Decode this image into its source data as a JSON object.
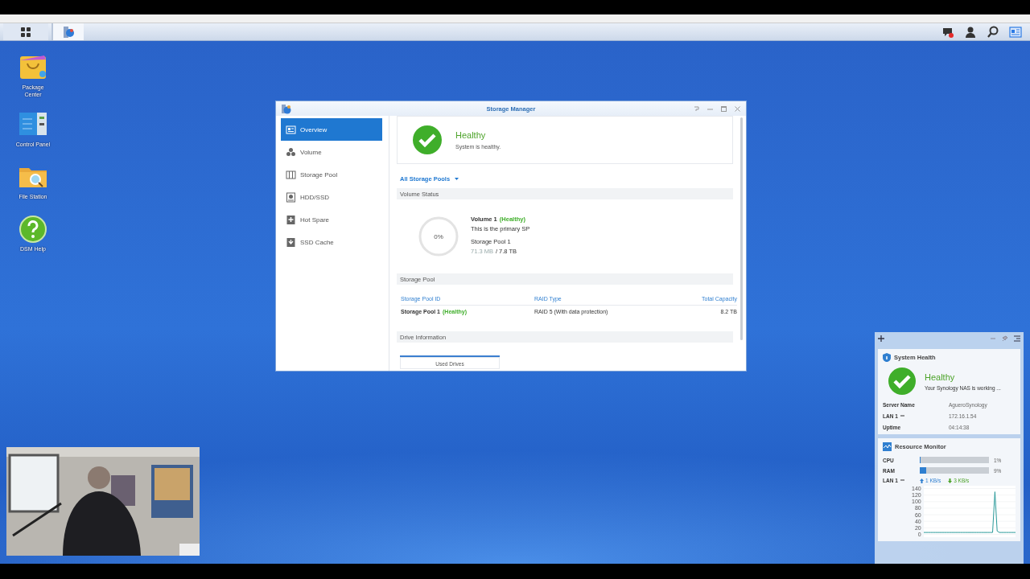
{
  "desktop_icons": [
    {
      "label": "Package Center",
      "kind": "package"
    },
    {
      "label": "Control Panel",
      "kind": "control"
    },
    {
      "label": "File Station",
      "kind": "folder"
    },
    {
      "label": "DSM Help",
      "kind": "help"
    }
  ],
  "storage_manager": {
    "title": "Storage Manager",
    "sidebar": [
      {
        "label": "Overview",
        "kind": "overview",
        "selected": true
      },
      {
        "label": "Volume",
        "kind": "volume",
        "selected": false
      },
      {
        "label": "Storage Pool",
        "kind": "pool",
        "selected": false
      },
      {
        "label": "HDD/SSD",
        "kind": "disk",
        "selected": false
      },
      {
        "label": "Hot Spare",
        "kind": "spare",
        "selected": false
      },
      {
        "label": "SSD Cache",
        "kind": "cache",
        "selected": false
      }
    ],
    "health": {
      "status": "Healthy",
      "message": "System is healthy."
    },
    "pool_filter": "All Storage Pools",
    "volume_status": {
      "heading": "Volume Status",
      "usage": "0%",
      "level": 0,
      "name": "Volume 1",
      "status": "(Healthy)",
      "description": "This is the primary SP",
      "pool": "Storage Pool 1",
      "used": "71.3 MB",
      "total": "/ 7.8 TB"
    },
    "storage_pool": {
      "heading": "Storage Pool",
      "columns": [
        "Storage Pool ID",
        "RAID Type",
        "Total Capacity"
      ],
      "rows": [
        {
          "name": "Storage Pool 1",
          "status": "(Healthy)",
          "raid": "RAID 5 (With data protection)",
          "capacity": "8.2 TB"
        }
      ]
    },
    "drive_information": {
      "heading": "Drive Information",
      "tab": "Used Drives"
    }
  },
  "system_health": {
    "title": "System Health",
    "status": "Healthy",
    "message": "Your Synology NAS is working ...",
    "rows": [
      {
        "label": "Server Name",
        "value": "AgueroSynology",
        "dropdown": false
      },
      {
        "label": "LAN 1",
        "value": "172.16.1.54",
        "dropdown": true
      },
      {
        "label": "Uptime",
        "value": "04:14:38",
        "dropdown": false
      }
    ]
  },
  "resource_monitor": {
    "title": "Resource Monitor",
    "meters": [
      {
        "label": "CPU",
        "level": 0.01,
        "reading": "1%"
      },
      {
        "label": "RAM",
        "level": 0.09,
        "reading": "9%"
      }
    ],
    "lan": {
      "label": "LAN 1",
      "upload": "1 KB/s",
      "download": "3 KB/s"
    },
    "chart_data": {
      "type": "line",
      "grid": true,
      "ylim": [
        0,
        140
      ],
      "yticks": [
        0,
        20,
        40,
        60,
        80,
        100,
        120,
        140
      ],
      "series": [
        {
          "color": "#2a9a9a",
          "values": [
            6,
            6,
            6,
            6,
            6,
            6,
            6,
            6,
            6,
            6,
            6,
            6,
            6,
            6,
            6,
            6,
            6,
            6,
            6,
            6,
            6,
            6,
            6,
            6,
            6,
            6,
            6,
            6,
            6,
            6,
            6,
            130,
            10,
            6,
            6,
            6,
            6,
            6,
            6,
            6,
            6
          ]
        }
      ]
    }
  }
}
